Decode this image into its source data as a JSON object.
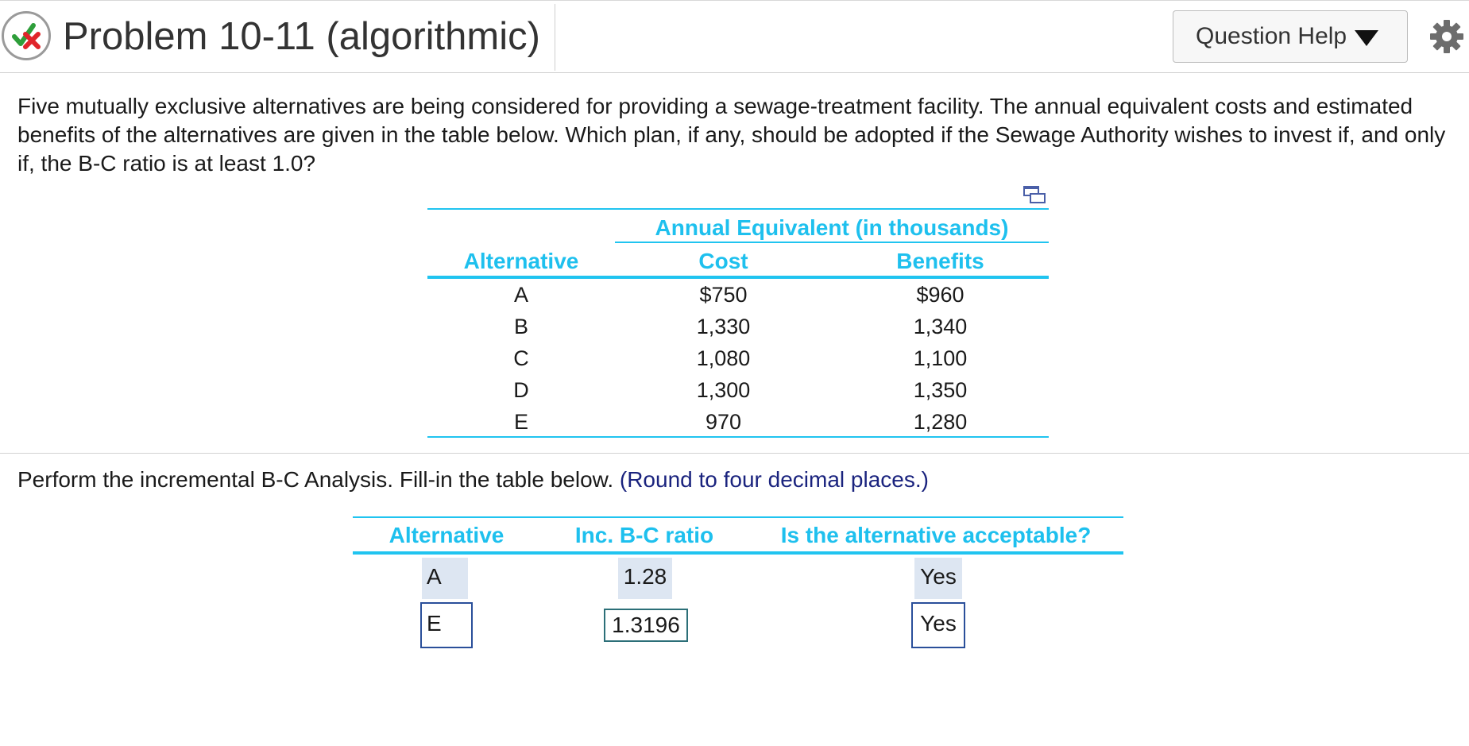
{
  "header": {
    "title": "Problem 10-11 (algorithmic)",
    "help_label": "Question Help",
    "colors": {
      "check": "#2e9e3a",
      "cross": "#e0242a",
      "accent": "#20c4f0"
    }
  },
  "problem": {
    "text": "Five mutually exclusive alternatives are being considered for providing a sewage-treatment facility. The annual equivalent costs and estimated benefits of the alternatives are given in the table below. Which plan, if any, should be adopted if the Sewage Authority wishes to invest if, and only if, the B-C ratio is at least 1.0?"
  },
  "data_table": {
    "group_header": "Annual Equivalent (in thousands)",
    "headers": {
      "alt": "Alternative",
      "cost": "Cost",
      "benefits": "Benefits"
    },
    "rows": [
      {
        "alt": "A",
        "cost": "$750",
        "benefits": "$960"
      },
      {
        "alt": "B",
        "cost": "1,330",
        "benefits": "1,340"
      },
      {
        "alt": "C",
        "cost": "1,080",
        "benefits": "1,100"
      },
      {
        "alt": "D",
        "cost": "1,300",
        "benefits": "1,350"
      },
      {
        "alt": "E",
        "cost": "970",
        "benefits": "1,280"
      }
    ]
  },
  "instruction": {
    "text": "Perform the incremental B-C Analysis. Fill-in the table below.",
    "hint": "(Round to four decimal places.)"
  },
  "answer_table": {
    "headers": {
      "alt": "Alternative",
      "ratio": "Inc. B-C ratio",
      "acceptable": "Is the alternative acceptable?"
    },
    "rows": [
      {
        "alt": "A",
        "ratio": "1.28",
        "acceptable": "Yes"
      },
      {
        "alt": "E",
        "ratio": "1.3196",
        "acceptable": "Yes"
      }
    ]
  }
}
